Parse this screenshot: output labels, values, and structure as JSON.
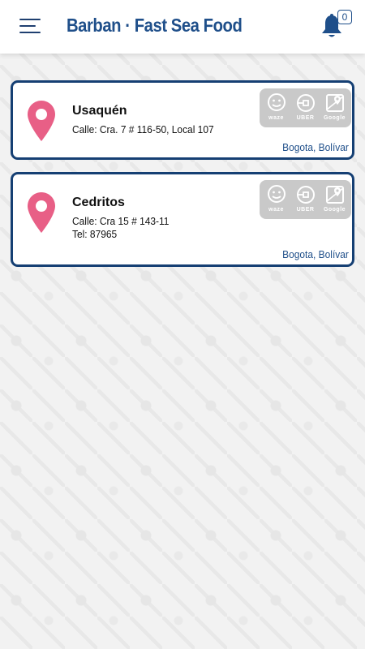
{
  "header": {
    "title": "Barban · Fast Sea Food",
    "notification_count": "0",
    "menu_icon": "hamburger-menu-icon",
    "bell_icon": "bell-icon"
  },
  "colors": {
    "brand_blue": "#1f4f8a",
    "card_border": "#153f73",
    "pin": "#e85f86",
    "nav_box": "#c9c9c9"
  },
  "locations": [
    {
      "name": "Usaquén",
      "address": "Calle: Cra. 7 # 116-50, Local 107",
      "phone": "",
      "city": "Bogota, Bolívar"
    },
    {
      "name": "Cedritos",
      "address": "Calle: Cra 15 # 143-11",
      "phone": "Tel: 87965",
      "city": "Bogota, Bolívar"
    }
  ],
  "nav_apps": {
    "waze": "waze",
    "uber": "UBER",
    "google": "Google"
  }
}
